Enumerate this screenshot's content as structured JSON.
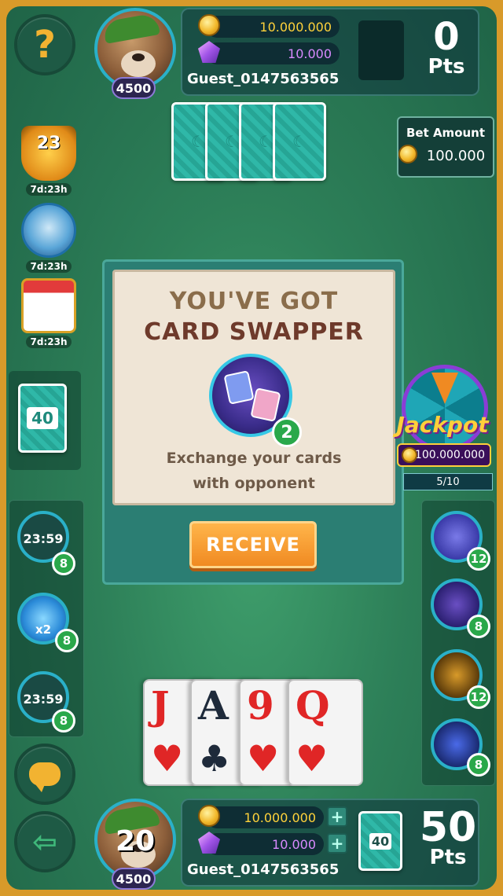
{
  "top_player": {
    "coins": "10.000.000",
    "gems": "10.000",
    "name": "Guest_0147563565",
    "level": "4500",
    "points": "0",
    "points_label": "Pts"
  },
  "bet": {
    "title": "Bet Amount",
    "amount": "100.000"
  },
  "events": [
    {
      "label": "23",
      "time": "7d:23h"
    },
    {
      "time": "7d:23h"
    },
    {
      "time": "7d:23h"
    }
  ],
  "deck": {
    "count": "40"
  },
  "modal": {
    "line1": "YOU'VE GOT",
    "line2": "CARD SWAPPER",
    "quantity": "2",
    "desc1": "Exchange your cards",
    "desc2": "with opponent",
    "button": "RECEIVE"
  },
  "jackpot": {
    "title": "Jackpot",
    "amount": "100.000.000",
    "progress": "5/10"
  },
  "left_powerups": [
    {
      "time": "23:59",
      "count": "8"
    },
    {
      "label": "x2",
      "count": "8"
    },
    {
      "time": "23:59",
      "count": "8"
    }
  ],
  "right_powerups": [
    {
      "count": "12"
    },
    {
      "count": "8"
    },
    {
      "count": "12"
    },
    {
      "count": "8"
    }
  ],
  "hand": [
    {
      "rank": "J",
      "suit": "♥"
    },
    {
      "rank": "A",
      "suit": "♣"
    },
    {
      "rank": "9",
      "suit": "♥"
    },
    {
      "rank": "Q",
      "suit": "♥"
    }
  ],
  "bottom_player": {
    "timer": "20",
    "coins": "10.000.000",
    "gems": "10.000",
    "name": "Guest_0147563565",
    "level": "4500",
    "deck_count": "40",
    "points": "50",
    "points_label": "Pts"
  },
  "colors": {
    "accent": "#f2b331",
    "table": "#2d7f58",
    "badge": "#2aa84a"
  }
}
